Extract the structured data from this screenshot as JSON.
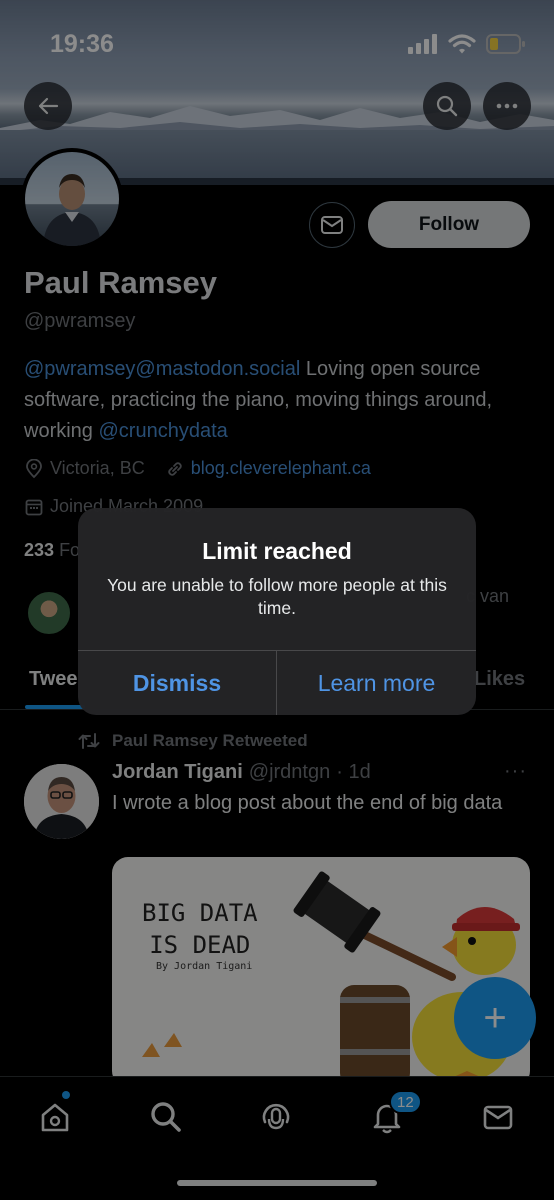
{
  "status_bar": {
    "time": "19:36"
  },
  "profile": {
    "follow_label": "Follow",
    "name": "Paul Ramsey",
    "handle": "@pwramsey",
    "bio_link1": "@pwramsey@mastodon.social",
    "bio_text1": " Loving open source software, practicing the piano, moving things around, working ",
    "bio_link2": "@crunchydata",
    "location": "Victoria, BC",
    "website": "blog.cleverelephant.ca",
    "joined": "Joined March 2009",
    "follows_count": "233",
    "follows_label": "Fo",
    "followed_by_partial": "c van"
  },
  "tabs": [
    {
      "label": "Twee"
    },
    {
      "label": "Likes"
    }
  ],
  "tweet": {
    "retweet_label": "Paul Ramsey Retweeted",
    "author": "Jordan Tigani",
    "handle": "@jrdntgn",
    "time": "· 1d",
    "more": "···",
    "text": "I wrote a blog post about the end of big data",
    "media_title_line1": "BIG DATA",
    "media_title_line2": "IS DEAD",
    "media_byline": "By Jordan Tigani"
  },
  "fab_label": "+",
  "nav": {
    "notifications_badge": "12"
  },
  "dialog": {
    "title": "Limit reached",
    "message": "You are unable to follow more people at this time.",
    "dismiss_label": "Dismiss",
    "learn_more_label": "Learn more"
  },
  "colors": {
    "accent": "#1d9bf0",
    "link": "#4a8fd6",
    "dialog_button": "#4f94e4"
  }
}
